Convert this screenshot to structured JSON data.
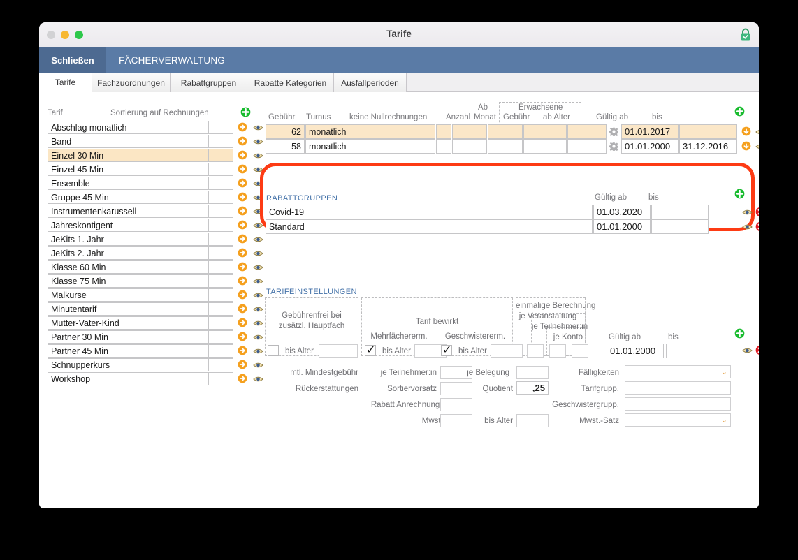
{
  "window": {
    "title": "Tarife",
    "lock_icon": "lock-closed-icon",
    "traffic": {
      "close": "close-button",
      "minimize": "minimize-button",
      "maximize": "maximize-button"
    }
  },
  "toolbar": {
    "close_label": "Schließen",
    "app_name": "FÄCHERVERWALTUNG",
    "bg_color": "#5a7ba6"
  },
  "tabs": [
    {
      "label": "Tarife",
      "active": true
    },
    {
      "label": "Fachzuordnungen",
      "active": false
    },
    {
      "label": "Rabattgruppen",
      "active": false
    },
    {
      "label": "Rabatte Kategorien",
      "active": false
    },
    {
      "label": "Ausfallperioden",
      "active": false
    }
  ],
  "tariff_list": {
    "headers": {
      "name": "Tarif",
      "sort": "Sortierung auf Rechnungen"
    },
    "add_icon": "plus-circle-icon",
    "rows": [
      {
        "name": "Abschlag monatlich",
        "sort": "",
        "selected": false
      },
      {
        "name": "Band",
        "sort": "",
        "selected": false
      },
      {
        "name": "Einzel 30 Min",
        "sort": "",
        "selected": true
      },
      {
        "name": "Einzel 45 Min",
        "sort": "",
        "selected": false
      },
      {
        "name": "Ensemble",
        "sort": "",
        "selected": false
      },
      {
        "name": "Gruppe 45 Min",
        "sort": "",
        "selected": false
      },
      {
        "name": "Instrumentenkarussell",
        "sort": "",
        "selected": false
      },
      {
        "name": "Jahreskontigent",
        "sort": "",
        "selected": false
      },
      {
        "name": "JeKits 1. Jahr",
        "sort": "",
        "selected": false
      },
      {
        "name": "JeKits 2. Jahr",
        "sort": "",
        "selected": false
      },
      {
        "name": "Klasse 60 Min",
        "sort": "",
        "selected": false
      },
      {
        "name": "Klasse 75 Min",
        "sort": "",
        "selected": false
      },
      {
        "name": "Malkurse",
        "sort": "",
        "selected": false
      },
      {
        "name": "Minutentarif",
        "sort": "",
        "selected": false
      },
      {
        "name": "Mutter-Vater-Kind",
        "sort": "",
        "selected": false
      },
      {
        "name": "Partner 30 Min",
        "sort": "",
        "selected": false
      },
      {
        "name": "Partner 45 Min",
        "sort": "",
        "selected": false
      },
      {
        "name": "Schnupperkurs",
        "sort": "",
        "selected": false
      },
      {
        "name": "Workshop",
        "sort": "",
        "selected": false
      }
    ],
    "row_icons": {
      "forward": "arrow-right-circle-icon",
      "preview": "eye-icon"
    }
  },
  "fee_table": {
    "highlight_color": "#fd3b14",
    "headers": {
      "gebuehr": "Gebühr",
      "turnus": "Turnus",
      "keine_nullrechnungen": "keine Nullrechnungen",
      "anzahl": "Anzahl",
      "ab_monat_1": "Ab",
      "ab_monat_2": "Monat",
      "erwachsene": "Erwachsene",
      "erw_gebuehr": "Gebühr",
      "erw_ab_alter": "ab Alter",
      "gueltig_ab": "Gültig ab",
      "bis": "bis"
    },
    "add_icon": "plus-circle-icon",
    "rows": [
      {
        "gebuehr": "62",
        "turnus": "monatlich",
        "keine_nullrechnungen": "",
        "anzahl": "",
        "ab_monat": "",
        "erw_gebuehr": "",
        "erw_ab_alter": "",
        "gueltig_ab": "01.01.2017",
        "bis": "",
        "selected": true
      },
      {
        "gebuehr": "58",
        "turnus": "monatlich",
        "keine_nullrechnungen": "",
        "anzahl": "",
        "ab_monat": "",
        "erw_gebuehr": "",
        "erw_ab_alter": "",
        "gueltig_ab": "01.01.2000",
        "bis": "31.12.2016",
        "selected": false
      }
    ],
    "row_icons": {
      "gear": "gear-icon",
      "down": "arrow-down-circle-icon",
      "preview": "eye-icon",
      "delete": "delete-circle-icon"
    }
  },
  "rabattgruppen": {
    "title": "RABATTGRUPPEN",
    "headers": {
      "gueltig_ab": "Gültig ab",
      "bis": "bis"
    },
    "add_icon": "plus-circle-icon",
    "rows": [
      {
        "name": "Covid-19",
        "gueltig_ab": "01.03.2020",
        "bis": ""
      },
      {
        "name": "Standard",
        "gueltig_ab": "01.01.2000",
        "bis": ""
      }
    ],
    "row_icons": {
      "preview": "eye-icon",
      "delete": "delete-circle-icon"
    }
  },
  "tarifeinstellungen": {
    "title": "TARIFEINSTELLUNGEN",
    "group_gebuehrenfrei": {
      "line1": "Gebührenfrei bei",
      "line2": "zusätzl. Hauptfach"
    },
    "group_tarif_bewirkt": "Tarif bewirkt",
    "group_einmalig": {
      "line1": "einmalige Berechnung",
      "line2": "je Veranstaltung",
      "line3": "je Teilnehmer:in",
      "line4": "je Konto"
    },
    "col_mehrfach": "Mehrfächererm.",
    "col_geschwister": "Geschwistererm.",
    "labels": {
      "bis_alter": "bis Alter",
      "mtl_mindestgebuehr": "mtl. Mindestgebühr",
      "rueckerstattungen": "Rückerstattungen",
      "je_teilnehmer": "je Teilnehmer:in",
      "sortiervorsatz": "Sortiervorsatz",
      "rabatt_anrechnungsminuten": "Rabatt Anrechnungsminuten",
      "mwst_ab_alter": "Mwst. ab Alter",
      "je_belegung": "je Belegung",
      "quotient": "Quotient",
      "bis_alter_2": "bis Alter",
      "faelligkeiten": "Fälligkeiten",
      "tarifgrupp": "Tarifgrupp.",
      "geschwistergrupp": "Geschwistergrupp.",
      "mwst_satz": "Mwst.-Satz",
      "gueltig_ab": "Gültig ab",
      "bis": "bis"
    },
    "values": {
      "gebuehrenfrei_checked": false,
      "gebuehrenfrei_bis_alter": "",
      "mtl_mindestgebuehr": "",
      "rueckerstattungen": "",
      "mehrfach_checked": true,
      "mehrfach_bis_alter": "",
      "je_teilnehmer": "",
      "sortiervorsatz": "",
      "rabatt_anrechnungsminuten": "",
      "mwst_ab_alter": "",
      "geschwister_checked": true,
      "geschwister_bis_alter": "",
      "je_belegung": "",
      "quotient": ",25",
      "bis_alter_2": "",
      "einmalig_veranstaltung": "",
      "einmalig_teilnehmer": "",
      "einmalig_konto": "",
      "gueltig_ab": "01.01.2000",
      "bis": "",
      "faelligkeiten": "",
      "tarifgrupp": "",
      "geschwistergrupp": "",
      "mwst_satz": ""
    },
    "add_icon": "plus-circle-icon",
    "row_icons": {
      "preview": "eye-icon",
      "delete": "delete-circle-icon"
    }
  }
}
